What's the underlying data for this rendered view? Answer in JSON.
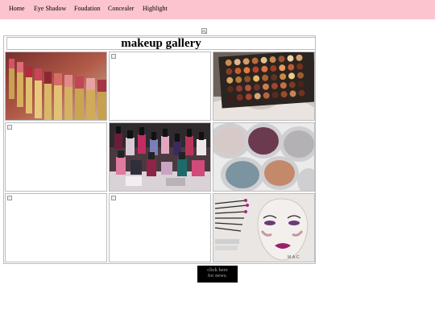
{
  "nav": {
    "items": [
      "Home",
      "Eye Shadow",
      "Foudation",
      "Concealer",
      "Highlight"
    ]
  },
  "gallery": {
    "title": "makeup gallery",
    "images": [
      {
        "name": "lipsticks-image",
        "loaded": true
      },
      {
        "name": "broken-image",
        "loaded": false
      },
      {
        "name": "eyeshadow-palette-image",
        "loaded": true
      },
      {
        "name": "broken-image",
        "loaded": false
      },
      {
        "name": "nail-polish-image",
        "loaded": true
      },
      {
        "name": "pigment-pots-image",
        "loaded": true
      },
      {
        "name": "broken-image",
        "loaded": false
      },
      {
        "name": "broken-image",
        "loaded": false
      },
      {
        "name": "face-chart-image",
        "loaded": true
      }
    ]
  },
  "news_button": {
    "line1": "click here",
    "line2": "for news."
  }
}
